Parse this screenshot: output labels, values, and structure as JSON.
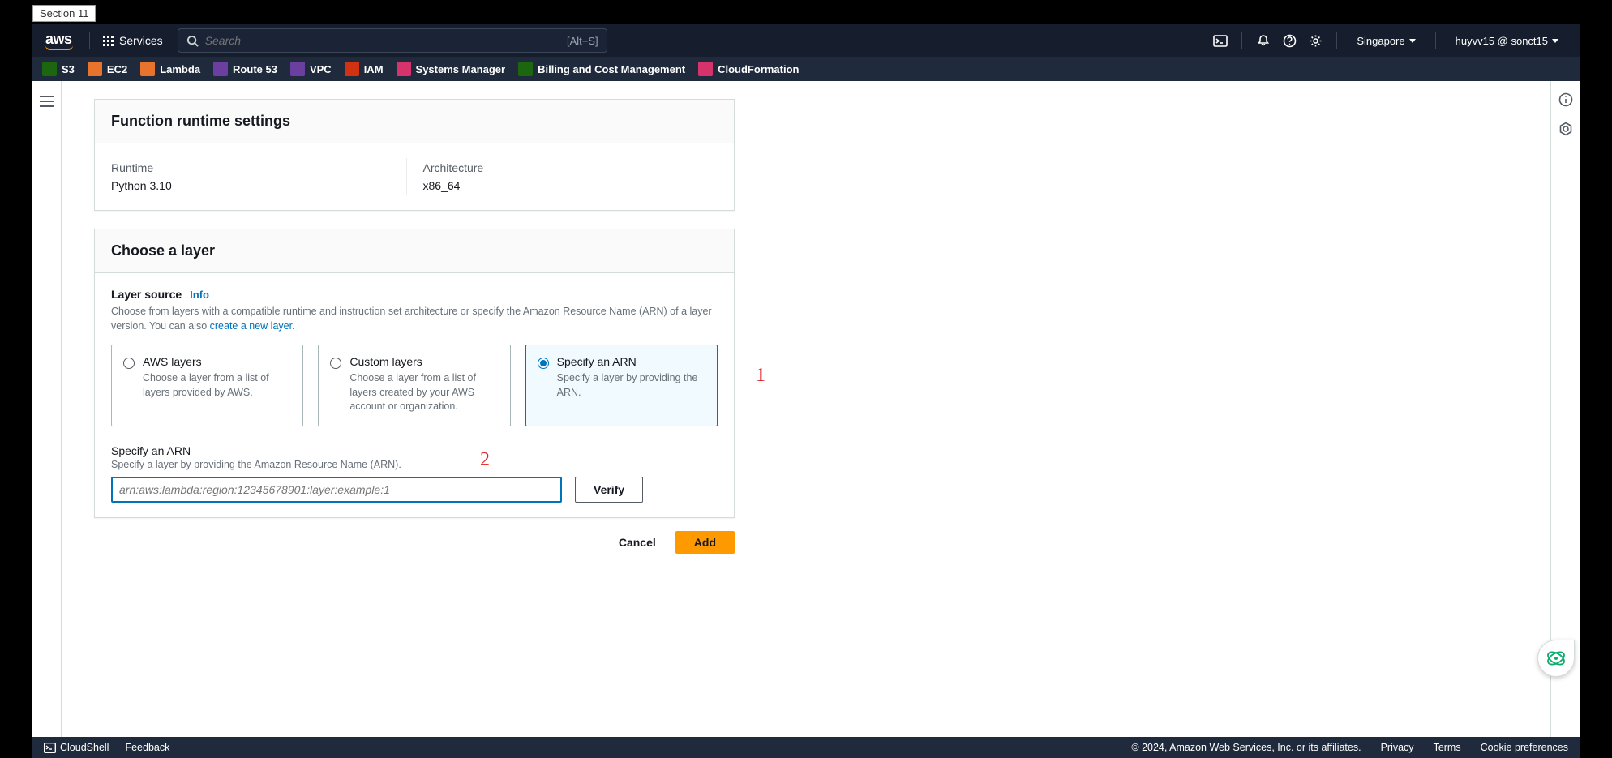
{
  "section_tab": "Section 11",
  "topnav": {
    "logo_text": "aws",
    "services_label": "Services",
    "search_placeholder": "Search",
    "search_shortcut": "[Alt+S]",
    "region": "Singapore",
    "account": "huyvv15 @ sonct15"
  },
  "favorites": [
    {
      "label": "S3",
      "color": "#1b660f"
    },
    {
      "label": "EC2",
      "color": "#e8732c"
    },
    {
      "label": "Lambda",
      "color": "#e8732c"
    },
    {
      "label": "Route 53",
      "color": "#6b3fa0"
    },
    {
      "label": "VPC",
      "color": "#6b3fa0"
    },
    {
      "label": "IAM",
      "color": "#d13212"
    },
    {
      "label": "Systems Manager",
      "color": "#d6336c"
    },
    {
      "label": "Billing and Cost Management",
      "color": "#1b660f"
    },
    {
      "label": "CloudFormation",
      "color": "#d6336c"
    }
  ],
  "runtime_card": {
    "title": "Function runtime settings",
    "runtime_label": "Runtime",
    "runtime_value": "Python 3.10",
    "arch_label": "Architecture",
    "arch_value": "x86_64"
  },
  "layer_card": {
    "title": "Choose a layer",
    "source_label": "Layer source",
    "info_label": "Info",
    "source_desc_1": "Choose from layers with a compatible runtime and instruction set architecture or specify the Amazon Resource Name (ARN) of a layer version. You can also ",
    "source_desc_link": "create a new layer.",
    "tiles": [
      {
        "title": "AWS layers",
        "desc": "Choose a layer from a list of layers provided by AWS."
      },
      {
        "title": "Custom layers",
        "desc": "Choose a layer from a list of layers created by your AWS account or organization."
      },
      {
        "title": "Specify an ARN",
        "desc": "Specify a layer by providing the ARN."
      }
    ],
    "arn_title": "Specify an ARN",
    "arn_desc": "Specify a layer by providing the Amazon Resource Name (ARN).",
    "arn_placeholder": "arn:aws:lambda:region:12345678901:layer:example:1",
    "verify_label": "Verify"
  },
  "actions": {
    "cancel": "Cancel",
    "add": "Add"
  },
  "annotations": {
    "one": "1",
    "two": "2"
  },
  "footer": {
    "cloudshell": "CloudShell",
    "feedback": "Feedback",
    "copy": "© 2024, Amazon Web Services, Inc. or its affiliates.",
    "privacy": "Privacy",
    "terms": "Terms",
    "cookies": "Cookie preferences"
  }
}
